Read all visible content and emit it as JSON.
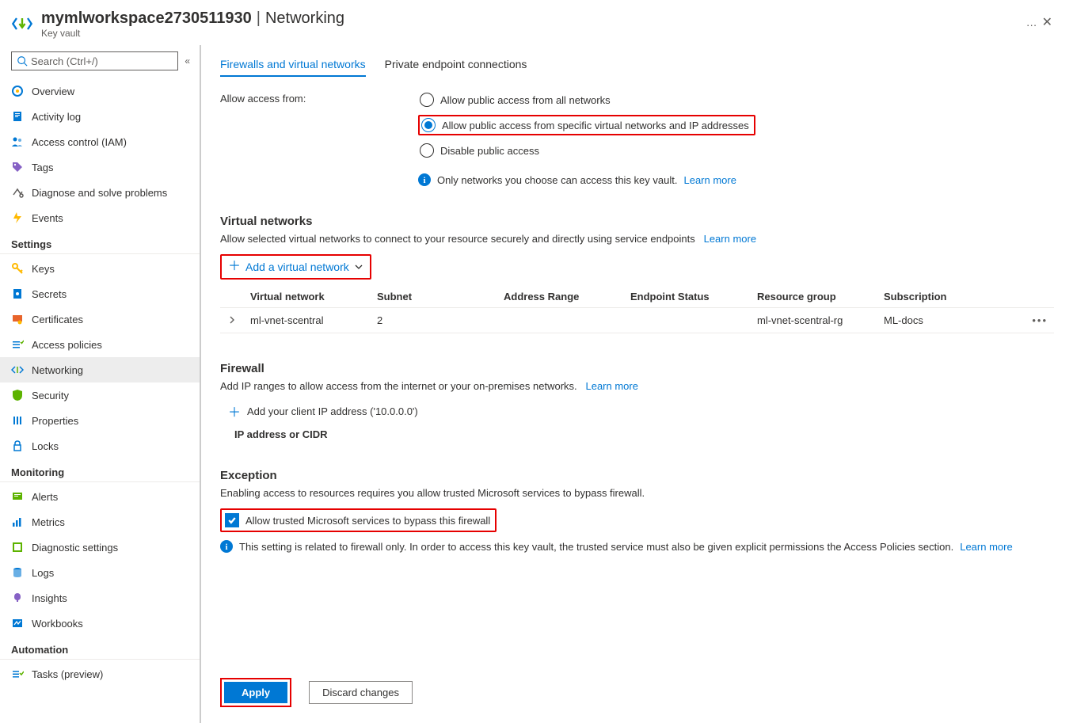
{
  "header": {
    "resource_name": "mymlworkspace2730511930",
    "separator": "|",
    "page_title": "Networking",
    "subtitle": "Key vault",
    "more": "…",
    "close": "✕"
  },
  "sidebar": {
    "search_placeholder": "Search (Ctrl+/)",
    "collapse": "«",
    "groups": [
      {
        "heading": null,
        "items": [
          {
            "id": "overview",
            "label": "Overview",
            "icon": "overview"
          },
          {
            "id": "activity",
            "label": "Activity log",
            "icon": "activity"
          },
          {
            "id": "iam",
            "label": "Access control (IAM)",
            "icon": "iam"
          },
          {
            "id": "tags",
            "label": "Tags",
            "icon": "tags"
          },
          {
            "id": "diagnose",
            "label": "Diagnose and solve problems",
            "icon": "diagnose"
          },
          {
            "id": "events",
            "label": "Events",
            "icon": "events"
          }
        ]
      },
      {
        "heading": "Settings",
        "items": [
          {
            "id": "keys",
            "label": "Keys",
            "icon": "keys"
          },
          {
            "id": "secrets",
            "label": "Secrets",
            "icon": "secrets"
          },
          {
            "id": "certs",
            "label": "Certificates",
            "icon": "certs"
          },
          {
            "id": "access-policies",
            "label": "Access policies",
            "icon": "access"
          },
          {
            "id": "networking",
            "label": "Networking",
            "icon": "networking",
            "active": true
          },
          {
            "id": "security",
            "label": "Security",
            "icon": "security"
          },
          {
            "id": "properties",
            "label": "Properties",
            "icon": "properties"
          },
          {
            "id": "locks",
            "label": "Locks",
            "icon": "locks"
          }
        ]
      },
      {
        "heading": "Monitoring",
        "items": [
          {
            "id": "alerts",
            "label": "Alerts",
            "icon": "alerts"
          },
          {
            "id": "metrics",
            "label": "Metrics",
            "icon": "metrics"
          },
          {
            "id": "diag",
            "label": "Diagnostic settings",
            "icon": "diag"
          },
          {
            "id": "logs",
            "label": "Logs",
            "icon": "logs"
          },
          {
            "id": "insights",
            "label": "Insights",
            "icon": "insights"
          },
          {
            "id": "workbooks",
            "label": "Workbooks",
            "icon": "workbooks"
          }
        ]
      },
      {
        "heading": "Automation",
        "items": [
          {
            "id": "tasks",
            "label": "Tasks (preview)",
            "icon": "tasks"
          }
        ]
      }
    ]
  },
  "tabs": {
    "firewalls": "Firewalls and virtual networks",
    "private": "Private endpoint connections"
  },
  "access": {
    "label": "Allow access from:",
    "opt_all": "Allow public access from all networks",
    "opt_selected": "Allow public access from specific virtual networks and IP addresses",
    "opt_disable": "Disable public access",
    "info": "Only networks you choose can access this key vault.",
    "learn": "Learn more"
  },
  "vnets": {
    "heading": "Virtual networks",
    "desc": "Allow selected virtual networks to connect to your resource securely and directly using service endpoints",
    "learn": "Learn more",
    "add_btn": "Add a virtual network",
    "cols": {
      "vnet": "Virtual network",
      "subnet": "Subnet",
      "range": "Address Range",
      "status": "Endpoint Status",
      "rg": "Resource group",
      "sub": "Subscription"
    },
    "rows": [
      {
        "vnet": "ml-vnet-scentral",
        "subnet": "2",
        "range": "",
        "status": "",
        "rg": "ml-vnet-scentral-rg",
        "sub": "ML-docs"
      }
    ]
  },
  "firewall": {
    "heading": "Firewall",
    "desc": "Add IP ranges to allow access from the internet or your on-premises networks.",
    "learn": "Learn more",
    "add_ip": "Add your client IP address ('10.0.0.0')",
    "ip_header": "IP address or CIDR"
  },
  "exception": {
    "heading": "Exception",
    "desc": "Enabling access to resources requires you allow trusted Microsoft services to bypass firewall.",
    "checkbox_label": "Allow trusted Microsoft services to bypass this firewall",
    "info": "This setting is related to firewall only. In order to access this key vault, the trusted service must also be given explicit permissions the Access Policies section.",
    "learn": "Learn more"
  },
  "footer": {
    "apply": "Apply",
    "discard": "Discard changes"
  }
}
